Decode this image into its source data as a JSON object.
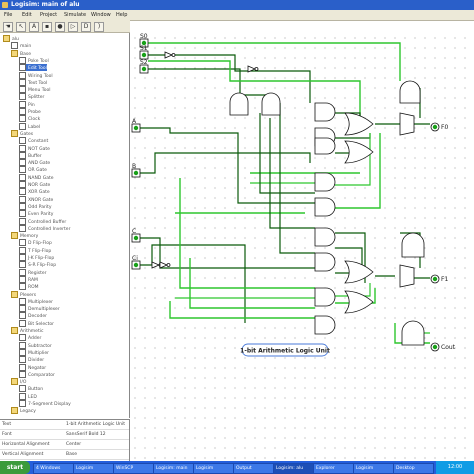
{
  "window": {
    "title": "Logisim: main of alu"
  },
  "menubar": {
    "items": [
      "File",
      "Edit",
      "Project",
      "Simulate",
      "Window",
      "Help"
    ]
  },
  "toolbar": {
    "tools": [
      {
        "icon": "hand-poke-icon",
        "glyph": "☚"
      },
      {
        "icon": "select-arrow-icon",
        "glyph": "↖"
      },
      {
        "icon": "text-tool-icon",
        "glyph": "A"
      },
      {
        "icon": "pin-in-icon",
        "glyph": "▪"
      },
      {
        "icon": "pin-out-icon",
        "glyph": "●"
      },
      {
        "icon": "not-gate-icon",
        "glyph": "▷"
      },
      {
        "icon": "and-gate-icon",
        "glyph": "D"
      },
      {
        "icon": "or-gate-icon",
        "glyph": ")"
      }
    ]
  },
  "sidebar": {
    "items": [
      {
        "label": "alu",
        "folder": true,
        "indent": 0
      },
      {
        "label": "main",
        "folder": false,
        "indent": 1
      },
      {
        "label": "Base",
        "folder": true,
        "indent": 1
      },
      {
        "label": "Poke Tool",
        "folder": false,
        "indent": 2
      },
      {
        "label": "Edit Tool",
        "folder": false,
        "indent": 2,
        "selected": true
      },
      {
        "label": "Wiring Tool",
        "folder": false,
        "indent": 2
      },
      {
        "label": "Text Tool",
        "folder": false,
        "indent": 2
      },
      {
        "label": "Menu Tool",
        "folder": false,
        "indent": 2
      },
      {
        "label": "Splitter",
        "folder": false,
        "indent": 2
      },
      {
        "label": "Pin",
        "folder": false,
        "indent": 2
      },
      {
        "label": "Probe",
        "folder": false,
        "indent": 2
      },
      {
        "label": "Clock",
        "folder": false,
        "indent": 2
      },
      {
        "label": "Label",
        "folder": false,
        "indent": 2
      },
      {
        "label": "Gates",
        "folder": true,
        "indent": 1
      },
      {
        "label": "Constant",
        "folder": false,
        "indent": 2
      },
      {
        "label": "NOT Gate",
        "folder": false,
        "indent": 2
      },
      {
        "label": "Buffer",
        "folder": false,
        "indent": 2
      },
      {
        "label": "AND Gate",
        "folder": false,
        "indent": 2
      },
      {
        "label": "OR Gate",
        "folder": false,
        "indent": 2
      },
      {
        "label": "NAND Gate",
        "folder": false,
        "indent": 2
      },
      {
        "label": "NOR Gate",
        "folder": false,
        "indent": 2
      },
      {
        "label": "XOR Gate",
        "folder": false,
        "indent": 2
      },
      {
        "label": "XNOR Gate",
        "folder": false,
        "indent": 2
      },
      {
        "label": "Odd Parity",
        "folder": false,
        "indent": 2
      },
      {
        "label": "Even Parity",
        "folder": false,
        "indent": 2
      },
      {
        "label": "Controlled Buffer",
        "folder": false,
        "indent": 2
      },
      {
        "label": "Controlled Inverter",
        "folder": false,
        "indent": 2
      },
      {
        "label": "Memory",
        "folder": true,
        "indent": 1
      },
      {
        "label": "D Flip-Flop",
        "folder": false,
        "indent": 2
      },
      {
        "label": "T Flip-Flop",
        "folder": false,
        "indent": 2
      },
      {
        "label": "J-K Flip-Flop",
        "folder": false,
        "indent": 2
      },
      {
        "label": "S-R Flip-Flop",
        "folder": false,
        "indent": 2
      },
      {
        "label": "Register",
        "folder": false,
        "indent": 2
      },
      {
        "label": "RAM",
        "folder": false,
        "indent": 2
      },
      {
        "label": "ROM",
        "folder": false,
        "indent": 2
      },
      {
        "label": "Plexers",
        "folder": true,
        "indent": 1
      },
      {
        "label": "Multiplexer",
        "folder": false,
        "indent": 2
      },
      {
        "label": "Demultiplexer",
        "folder": false,
        "indent": 2
      },
      {
        "label": "Decoder",
        "folder": false,
        "indent": 2
      },
      {
        "label": "Bit Selector",
        "folder": false,
        "indent": 2
      },
      {
        "label": "Arithmetic",
        "folder": true,
        "indent": 1
      },
      {
        "label": "Adder",
        "folder": false,
        "indent": 2
      },
      {
        "label": "Subtractor",
        "folder": false,
        "indent": 2
      },
      {
        "label": "Multiplier",
        "folder": false,
        "indent": 2
      },
      {
        "label": "Divider",
        "folder": false,
        "indent": 2
      },
      {
        "label": "Negator",
        "folder": false,
        "indent": 2
      },
      {
        "label": "Comparator",
        "folder": false,
        "indent": 2
      },
      {
        "label": "I/O",
        "folder": true,
        "indent": 1
      },
      {
        "label": "Button",
        "folder": false,
        "indent": 2
      },
      {
        "label": "LED",
        "folder": false,
        "indent": 2
      },
      {
        "label": "7-Segment Display",
        "folder": false,
        "indent": 2
      },
      {
        "label": "Legacy",
        "folder": true,
        "indent": 1
      }
    ]
  },
  "attributes": {
    "rows": [
      {
        "key": "Text",
        "value": "1-bit Arithmetic Logic Unit"
      },
      {
        "key": "Font",
        "value": "SansSerif Bold 12"
      },
      {
        "key": "Horizontal Alignment",
        "value": "Center"
      },
      {
        "key": "Vertical Alignment",
        "value": "Base"
      }
    ]
  },
  "canvas": {
    "pins": {
      "s0": "S0",
      "s1": "S1",
      "s2": "S2",
      "a": "A",
      "b": "B",
      "c": "C",
      "ci": "Ci",
      "f0": "F0",
      "f1": "F1",
      "cout": "Cout"
    },
    "circuit_label": "1-bit Arithmetic Logic Unit"
  },
  "taskbar": {
    "start": "start",
    "tasks": [
      "4 Windows",
      "Logisim",
      "WinSCP",
      "Logisim: main",
      "Logisim",
      "Output",
      "Logisim: alu",
      "Explorer",
      "Logisim",
      "Desktop"
    ],
    "active_index": 6,
    "clock": "12:00"
  },
  "colors": {
    "wire_on": "#2ec62e",
    "wire_dark": "#0b5b0b",
    "wire_off": "#1a7a1a",
    "titlebar": "#2a5fc9",
    "selection": "#3a6fd0"
  }
}
